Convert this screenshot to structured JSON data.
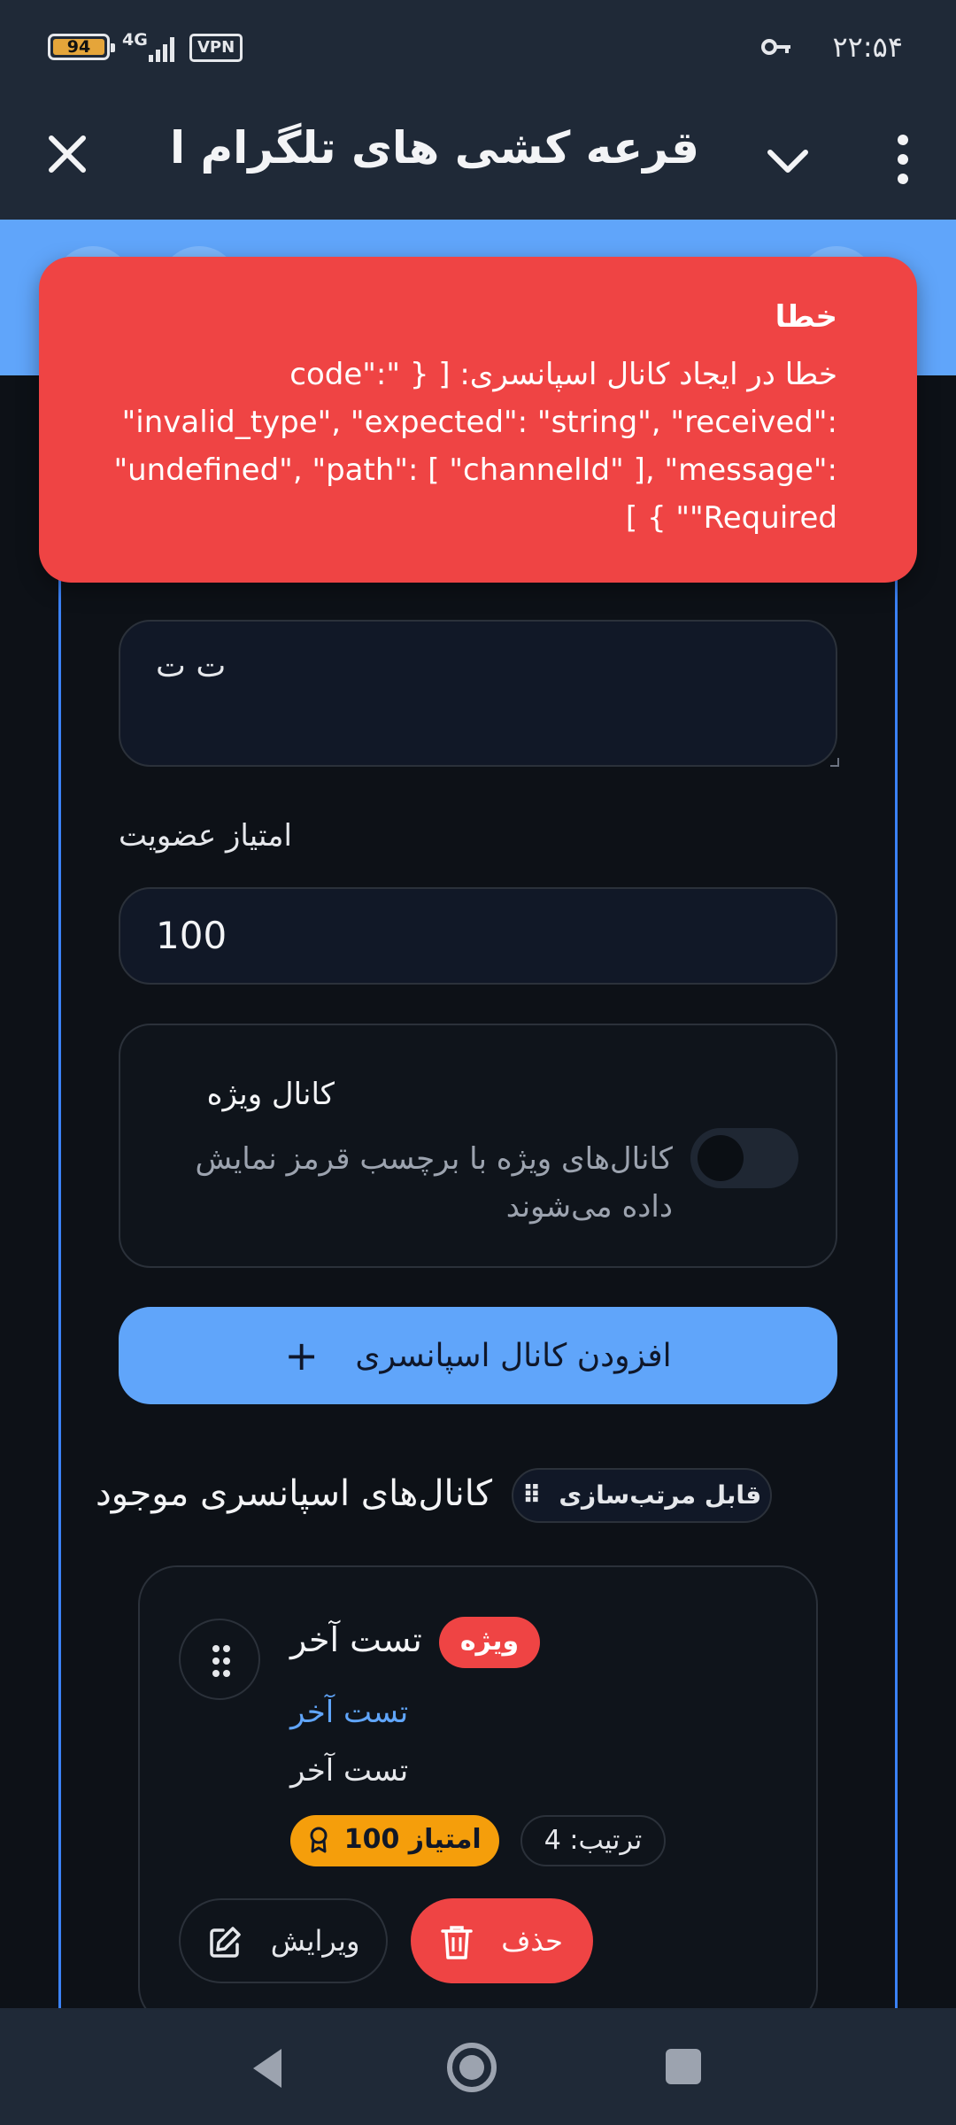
{
  "status_bar": {
    "battery": "94",
    "network": "4G",
    "vpn": "VPN",
    "time": "۲۲:۵۴"
  },
  "app_bar": {
    "title": "قرعه کشی های تلگرام اس..."
  },
  "toast": {
    "title": "خطا",
    "message": "خطا در ایجاد کانال اسپانسری: [ { \"code\": \"invalid_type\", \"expected\": \"string\", \"received\": \"undefined\", \"path\": [ \"channelId\" ], \"message\": \"Required\" } ]"
  },
  "form": {
    "description_value": "ت ت",
    "score_label": "امتیاز عضویت",
    "score_value": "100",
    "special_title": "کانال ویژه",
    "special_desc": "کانال‌های ویژه با برچسب قرمز نمایش داده می‌شوند",
    "special_enabled": false,
    "add_button": "افزودن کانال اسپانسری"
  },
  "existing": {
    "title": "کانال‌های اسپانسری موجود",
    "sortable_label": "قابل مرتب‌سازی",
    "items": [
      {
        "title": "تست آخر",
        "badge": "ویژه",
        "link": "تست آخر",
        "description": "تست آخر",
        "score": "امتیاز 100",
        "order": "ترتیب: 4",
        "edit": "ویرایش",
        "delete": "حذف"
      }
    ]
  },
  "colors": {
    "accent": "#60a5fa",
    "danger": "#ef4444",
    "warning": "#f59e0b",
    "background": "#0d1117",
    "bar": "#1f2937"
  },
  "icons": [
    "key-icon",
    "close-icon",
    "chevron-down-icon",
    "more-vert-icon",
    "plus-icon",
    "drag-handle-icon",
    "award-icon",
    "edit-icon",
    "trash-icon",
    "back-icon",
    "home-icon",
    "recents-icon"
  ]
}
